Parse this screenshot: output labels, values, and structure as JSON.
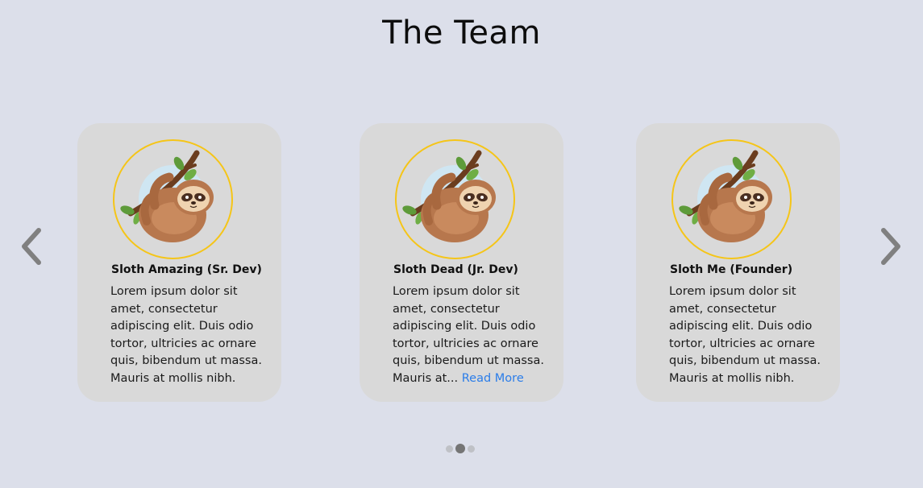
{
  "page": {
    "title": "The Team"
  },
  "navigation": {
    "prev_icon": "chevron-left-icon",
    "next_icon": "chevron-right-icon"
  },
  "team": [
    {
      "name": "Sloth Amazing (Sr. Dev)",
      "bio_lines": [
        "Lorem ipsum dolor sit",
        "amet, consectetur",
        "adipiscing elit. Duis odio",
        "tortor, ultricies ac ornare",
        "quis, bibendum ut massa.",
        "Mauris at mollis nibh."
      ],
      "avatar": "sloth-avatar"
    },
    {
      "name": "Sloth Dead (Jr. Dev)",
      "bio_lines": [
        "Lorem ipsum dolor sit",
        "amet, consectetur",
        "adipiscing elit. Duis odio",
        "tortor, ultricies ac ornare",
        "quis, bibendum ut massa.",
        "Mauris at..."
      ],
      "read_more": "Read More",
      "avatar": "sloth-avatar"
    },
    {
      "name": "Sloth Me (Founder)",
      "bio_lines": [
        "Lorem ipsum dolor sit",
        "amet, consectetur",
        "adipiscing elit. Duis odio",
        "tortor, ultricies ac ornare",
        "quis, bibendum ut massa.",
        "Mauris at mollis nibh."
      ],
      "avatar": "sloth-avatar"
    }
  ],
  "pagination": {
    "count": 3,
    "active_index": 1
  },
  "colors": {
    "background": "#dcdfea",
    "card": "#d9d9d9",
    "avatar_ring": "#f5c518",
    "link": "#2b7de9",
    "arrow": "#808080",
    "dot_active": "#757575",
    "dot_inactive": "#bfc1c6"
  }
}
